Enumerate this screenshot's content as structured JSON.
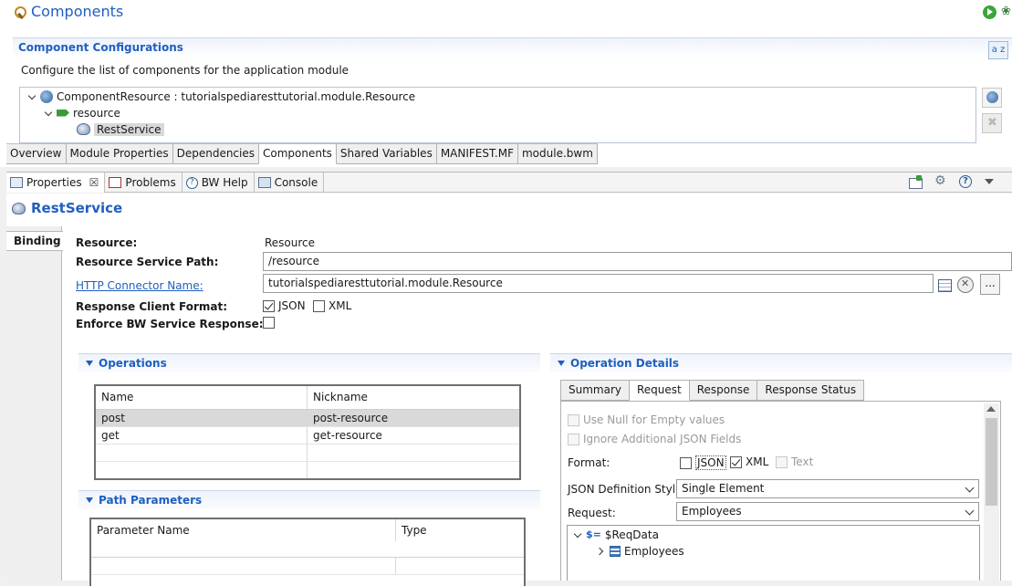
{
  "editor": {
    "title": "Components",
    "section_title": "Component Configurations",
    "description": "Configure the list of components for the application module",
    "sort_button_label": "a z",
    "tree": {
      "root_label": "ComponentResource : tutorialspediaresttutorial.module.Resource",
      "child_label": "resource",
      "leaf_label": "RestService"
    },
    "tabs": [
      "Overview",
      "Module Properties",
      "Dependencies",
      "Components",
      "Shared Variables",
      "MANIFEST.MF",
      "module.bwm"
    ],
    "active_tab": "Components"
  },
  "views": {
    "tabs": [
      {
        "label": "Properties",
        "closable_glyph": "☒"
      },
      {
        "label": "Problems"
      },
      {
        "label": "BW Help"
      },
      {
        "label": "Console"
      }
    ],
    "help_glyph": "?"
  },
  "properties": {
    "title": "RestService",
    "side_tab": "Binding",
    "fields": {
      "resource_label": "Resource:",
      "resource_value": "Resource",
      "path_label": "Resource Service Path:",
      "path_value": "/resource",
      "connector_label": "HTTP Connector Name:",
      "connector_value": "tutorialspediaresttutorial.module.Resource",
      "connector_more": "...",
      "format_label": "Response Client Format:",
      "format_json": "JSON",
      "format_xml": "XML",
      "enforce_label": "Enforce BW Service Response:"
    },
    "format_json_checked": true,
    "format_xml_checked": false,
    "enforce_checked": false
  },
  "operations": {
    "title": "Operations",
    "columns": [
      "Name",
      "Nickname"
    ],
    "rows": [
      {
        "name": "post",
        "nickname": "post-resource"
      },
      {
        "name": "get",
        "nickname": "get-resource"
      }
    ]
  },
  "path_parameters": {
    "title": "Path Parameters",
    "columns": [
      "Parameter Name",
      "Type"
    ]
  },
  "operation_details": {
    "title": "Operation Details",
    "tabs": [
      "Summary",
      "Request",
      "Response",
      "Response Status"
    ],
    "active_tab": "Request",
    "use_null_label": "Use Null for Empty values",
    "ignore_json_label": "Ignore Additional JSON Fields",
    "format_label": "Format:",
    "format_json": "JSON",
    "format_xml": "XML",
    "format_text": "Text",
    "format_xml_checked": true,
    "json_style_label": "JSON Definition Style:",
    "json_style_value": "Single Element",
    "request_label": "Request:",
    "request_value": "Employees",
    "tree": {
      "root_prefix": "$=",
      "root_label": "$ReqData",
      "child_label": "Employees"
    }
  }
}
